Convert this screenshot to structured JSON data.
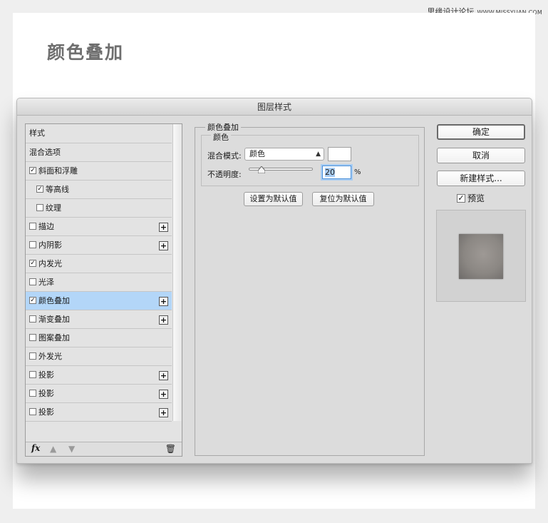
{
  "watermark": {
    "site": "思缘设计论坛",
    "url": "WWW.MISSYUAN.COM"
  },
  "heading": "颜色叠加",
  "dialog": {
    "title": "图层样式",
    "styles_list": [
      {
        "label": "样式",
        "checkbox": false,
        "plus": false,
        "indent": false,
        "selected": false
      },
      {
        "label": "混合选项",
        "checkbox": false,
        "plus": false,
        "indent": false,
        "selected": false
      },
      {
        "label": "斜面和浮雕",
        "checkbox": true,
        "checked": true,
        "plus": false,
        "indent": false,
        "selected": false
      },
      {
        "label": "等高线",
        "checkbox": true,
        "checked": true,
        "plus": false,
        "indent": true,
        "selected": false
      },
      {
        "label": "纹理",
        "checkbox": true,
        "checked": false,
        "plus": false,
        "indent": true,
        "selected": false
      },
      {
        "label": "描边",
        "checkbox": true,
        "checked": false,
        "plus": true,
        "indent": false,
        "selected": false
      },
      {
        "label": "内阴影",
        "checkbox": true,
        "checked": false,
        "plus": true,
        "indent": false,
        "selected": false
      },
      {
        "label": "内发光",
        "checkbox": true,
        "checked": true,
        "plus": false,
        "indent": false,
        "selected": false
      },
      {
        "label": "光泽",
        "checkbox": true,
        "checked": false,
        "plus": false,
        "indent": false,
        "selected": false
      },
      {
        "label": "颜色叠加",
        "checkbox": true,
        "checked": true,
        "plus": true,
        "indent": false,
        "selected": true
      },
      {
        "label": "渐变叠加",
        "checkbox": true,
        "checked": false,
        "plus": true,
        "indent": false,
        "selected": false
      },
      {
        "label": "图案叠加",
        "checkbox": true,
        "checked": false,
        "plus": false,
        "indent": false,
        "selected": false
      },
      {
        "label": "外发光",
        "checkbox": true,
        "checked": false,
        "plus": false,
        "indent": false,
        "selected": false
      },
      {
        "label": "投影",
        "checkbox": true,
        "checked": false,
        "plus": true,
        "indent": false,
        "selected": false
      },
      {
        "label": "投影",
        "checkbox": true,
        "checked": false,
        "plus": true,
        "indent": false,
        "selected": false
      },
      {
        "label": "投影",
        "checkbox": true,
        "checked": false,
        "plus": true,
        "indent": false,
        "selected": false
      }
    ],
    "footer": {
      "fx": "fx",
      "trash_icon": "trash-icon",
      "up_icon": "arrow-up-icon",
      "down_icon": "arrow-down-icon"
    },
    "panel": {
      "group_title": "颜色叠加",
      "subgroup_title": "颜色",
      "blend_mode_label": "混合模式:",
      "blend_mode_value": "颜色",
      "swatch_color": "#ffffff",
      "opacity_label": "不透明度:",
      "opacity_value": "20",
      "opacity_unit": "%",
      "opacity_fraction": 0.2,
      "make_default_label": "设置为默认值",
      "reset_default_label": "复位为默认值"
    },
    "actions": {
      "ok_label": "确定",
      "cancel_label": "取消",
      "new_style_label": "新建样式...",
      "preview_label": "预览",
      "preview_checked": true
    }
  },
  "colors": {
    "selected_row": "#b3d6f8",
    "dialog_bg": "#dcdcdc",
    "heading": "#6f6f6f"
  }
}
